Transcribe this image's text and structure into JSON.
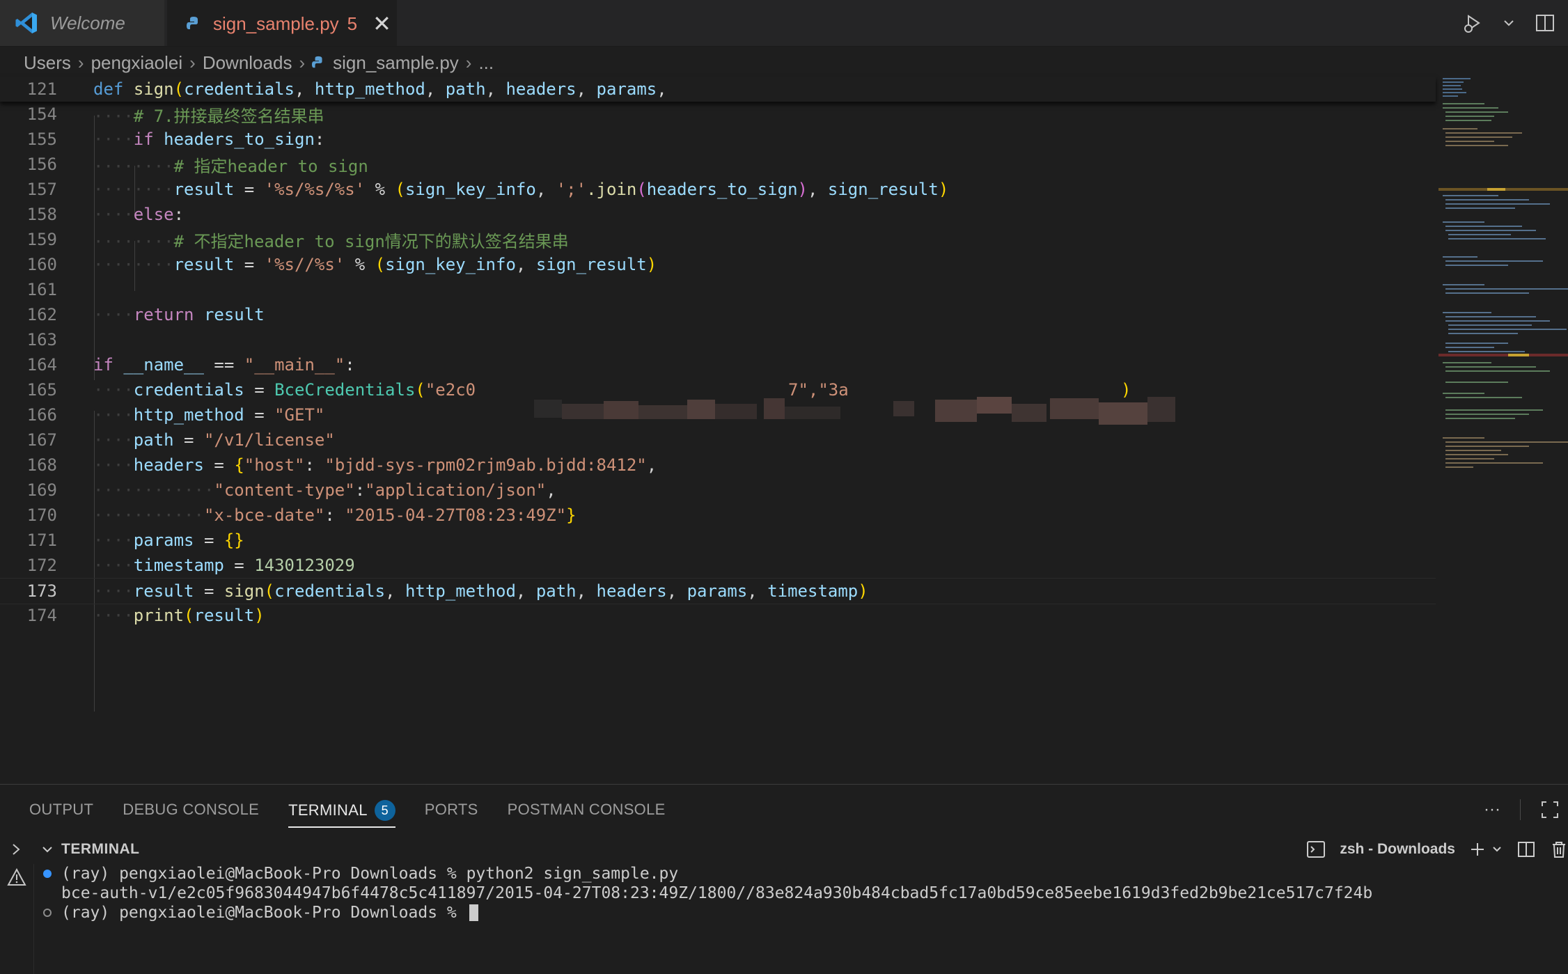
{
  "tabs": {
    "welcome": "Welcome",
    "file": "sign_sample.py",
    "file_problems": "5",
    "close": "✕"
  },
  "breadcrumb": {
    "parts": [
      "Users",
      "pengxiaolei",
      "Downloads",
      "sign_sample.py",
      "..."
    ]
  },
  "editor": {
    "current_line": "173",
    "lines": [
      {
        "n": "121"
      },
      {
        "n": "154"
      },
      {
        "n": "155"
      },
      {
        "n": "156"
      },
      {
        "n": "157"
      },
      {
        "n": "158"
      },
      {
        "n": "159"
      },
      {
        "n": "160"
      },
      {
        "n": "161"
      },
      {
        "n": "162"
      },
      {
        "n": "163"
      },
      {
        "n": "164"
      },
      {
        "n": "165"
      },
      {
        "n": "166"
      },
      {
        "n": "167"
      },
      {
        "n": "168"
      },
      {
        "n": "169"
      },
      {
        "n": "170"
      },
      {
        "n": "171"
      },
      {
        "n": "172"
      },
      {
        "n": "173"
      },
      {
        "n": "174"
      }
    ],
    "t": {
      "def": "def",
      "sign": "sign",
      "credentials": "credentials",
      "http_method": "http_method",
      "path": "path",
      "headers": "headers",
      "params": "params",
      "comma": ",",
      "comma_sp": ", ",
      "lparen": "(",
      "rparen": ")",
      "c154": "# 7.拼接最终签名结果串",
      "if": "if",
      "headers_to_sign": "headers_to_sign",
      "colon": ":",
      "c156": "# 指定header to sign",
      "result": "result",
      "eq": " = ",
      "fmt1": "'%s/%s/%s'",
      "pct": " % ",
      "sign_key_info": "sign_key_info",
      "semi": "';'",
      "join": ".join",
      "sign_result": "sign_result",
      "else": "else",
      "c159": "# 不指定header to sign情况下的默认签名结果串",
      "fmt2": "'%s//%s'",
      "return": "return",
      "name": "__name__",
      "eqeq": " == ",
      "main": "\"__main__\"",
      "BceCredentials": "BceCredentials",
      "cred_a": "\"e2c0",
      "cred_b": "7\",\"3a",
      "get": "\"GET\"",
      "license": "\"/v1/license\"",
      "lbrace": "{",
      "rbrace": "}",
      "host_k": "\"host\"",
      "host_v": "\"bjdd-sys-rpm02rjm9ab.bjdd:8412\"",
      "ct_k": "\"content-type\"",
      "ct_v": "\"application/json\"",
      "date_k": "\"x-bce-date\"",
      "date_v": "\"2015-04-27T08:23:49Z\"",
      "emptydict": "{}",
      "timestamp": "timestamp",
      "ts_val": "1430123029",
      "print": "print",
      "colon_sp": ": "
    }
  },
  "panel": {
    "tabs": [
      "OUTPUT",
      "DEBUG CONSOLE",
      "TERMINAL",
      "PORTS",
      "POSTMAN CONSOLE"
    ],
    "terminal_badge": "5",
    "more": "···",
    "terminal_title": "TERMINAL",
    "shell_label": "zsh - Downloads"
  },
  "terminal": {
    "line1": "(ray) pengxiaolei@MacBook-Pro Downloads % python2 sign_sample.py",
    "line2": "bce-auth-v1/e2c05f9683044947b6f4478c5c411897/2015-04-27T08:23:49Z/1800//83e824a930b484cbad5fc17a0bd59ce85eebe1619d3fed2b9be21ce517c7f24b",
    "line3": "(ray) pengxiaolei@MacBook-Pro Downloads % "
  },
  "colors": {
    "accent": "#0e639c",
    "modified_tab": "#e8826e",
    "keyword": "#c586c0",
    "string": "#ce9178",
    "comment": "#6a9955"
  }
}
